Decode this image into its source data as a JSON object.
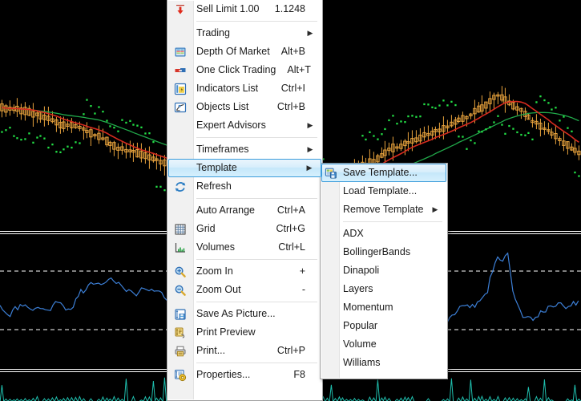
{
  "app": {
    "kind": "trading-terminal-chart-context-menu",
    "background_color": "#000000"
  },
  "chart_data": {
    "type": "line",
    "title": "",
    "panes": [
      {
        "name": "price",
        "type": "candlestick",
        "series": [
          {
            "name": "candles",
            "color": "#e8a33d"
          },
          {
            "name": "ma-fast",
            "color": "#d62b1f"
          },
          {
            "name": "ma-slow",
            "color": "#21a94a"
          },
          {
            "name": "parabolic-sar",
            "color": "#23e046"
          }
        ]
      },
      {
        "name": "oscillator",
        "type": "line",
        "series": [
          {
            "name": "rsi",
            "color": "#3c7fd6"
          }
        ],
        "levels": [
          70,
          30
        ],
        "level_style": "dashed",
        "level_color": "#ffffff"
      },
      {
        "name": "volumes",
        "type": "bar",
        "series": [
          {
            "name": "volume",
            "color": "#1fbfae"
          }
        ]
      }
    ]
  },
  "context_menu": {
    "name": "chart-context-menu",
    "items": [
      {
        "id": "sell-limit",
        "icon": "down-arrow-icon",
        "label": "Sell Limit 1.00",
        "accel": "1.1248",
        "arrow": false,
        "state": "normal"
      },
      {
        "id": "separator-1",
        "type": "separator"
      },
      {
        "id": "trading",
        "icon": "none",
        "label": "Trading",
        "accel": "",
        "arrow": true,
        "state": "normal"
      },
      {
        "id": "depth-of-market",
        "icon": "depth-of-market-icon",
        "label": "Depth Of Market",
        "accel": "Alt+B",
        "arrow": false,
        "state": "normal"
      },
      {
        "id": "one-click-trading",
        "icon": "one-click-trading-icon",
        "label": "One Click Trading",
        "accel": "Alt+T",
        "arrow": false,
        "state": "normal"
      },
      {
        "id": "indicators-list",
        "icon": "indicators-list-icon",
        "label": "Indicators List",
        "accel": "Ctrl+I",
        "arrow": false,
        "state": "normal"
      },
      {
        "id": "objects-list",
        "icon": "objects-list-icon",
        "label": "Objects List",
        "accel": "Ctrl+B",
        "arrow": false,
        "state": "normal"
      },
      {
        "id": "expert-advisors",
        "icon": "none",
        "label": "Expert Advisors",
        "accel": "",
        "arrow": true,
        "state": "normal"
      },
      {
        "id": "separator-2",
        "type": "separator"
      },
      {
        "id": "timeframes",
        "icon": "none",
        "label": "Timeframes",
        "accel": "",
        "arrow": true,
        "state": "normal"
      },
      {
        "id": "template",
        "icon": "none",
        "label": "Template",
        "accel": "",
        "arrow": true,
        "state": "highlighted"
      },
      {
        "id": "refresh",
        "icon": "refresh-icon",
        "label": "Refresh",
        "accel": "",
        "arrow": false,
        "state": "normal"
      },
      {
        "id": "separator-3",
        "type": "separator"
      },
      {
        "id": "auto-arrange",
        "icon": "none",
        "label": "Auto Arrange",
        "accel": "Ctrl+A",
        "arrow": false,
        "state": "normal"
      },
      {
        "id": "grid",
        "icon": "grid-icon",
        "label": "Grid",
        "accel": "Ctrl+G",
        "arrow": false,
        "state": "normal"
      },
      {
        "id": "volumes",
        "icon": "volumes-icon",
        "label": "Volumes",
        "accel": "Ctrl+L",
        "arrow": false,
        "state": "normal"
      },
      {
        "id": "separator-4",
        "type": "separator"
      },
      {
        "id": "zoom-in",
        "icon": "zoom-in-icon",
        "label": "Zoom In",
        "accel": "+",
        "arrow": false,
        "state": "normal"
      },
      {
        "id": "zoom-out",
        "icon": "zoom-out-icon",
        "label": "Zoom Out",
        "accel": "-",
        "arrow": false,
        "state": "normal"
      },
      {
        "id": "separator-5",
        "type": "separator"
      },
      {
        "id": "save-as-picture",
        "icon": "save-as-picture-icon",
        "label": "Save As Picture...",
        "accel": "",
        "arrow": false,
        "state": "normal"
      },
      {
        "id": "print-preview",
        "icon": "print-preview-icon",
        "label": "Print Preview",
        "accel": "",
        "arrow": false,
        "state": "normal"
      },
      {
        "id": "print",
        "icon": "print-icon",
        "label": "Print...",
        "accel": "Ctrl+P",
        "arrow": false,
        "state": "normal"
      },
      {
        "id": "separator-6",
        "type": "separator"
      },
      {
        "id": "properties",
        "icon": "properties-icon",
        "label": "Properties...",
        "accel": "F8",
        "arrow": false,
        "state": "normal"
      }
    ]
  },
  "template_submenu": {
    "name": "template-submenu",
    "items": [
      {
        "id": "save-template",
        "icon": "save-template-icon",
        "label": "Save Template...",
        "arrow": false,
        "state": "highlighted"
      },
      {
        "id": "load-template",
        "icon": "none",
        "label": "Load Template...",
        "arrow": false,
        "state": "normal"
      },
      {
        "id": "remove-template",
        "icon": "none",
        "label": "Remove Template",
        "arrow": true,
        "state": "normal"
      },
      {
        "id": "separator-1",
        "type": "separator"
      },
      {
        "id": "adx",
        "icon": "none",
        "label": "ADX",
        "arrow": false,
        "state": "normal"
      },
      {
        "id": "bollingerbands",
        "icon": "none",
        "label": "BollingerBands",
        "arrow": false,
        "state": "normal"
      },
      {
        "id": "dinapoli",
        "icon": "none",
        "label": "Dinapoli",
        "arrow": false,
        "state": "normal"
      },
      {
        "id": "layers",
        "icon": "none",
        "label": "Layers",
        "arrow": false,
        "state": "normal"
      },
      {
        "id": "momentum",
        "icon": "none",
        "label": "Momentum",
        "arrow": false,
        "state": "normal"
      },
      {
        "id": "popular",
        "icon": "none",
        "label": "Popular",
        "arrow": false,
        "state": "normal"
      },
      {
        "id": "volume",
        "icon": "none",
        "label": "Volume",
        "arrow": false,
        "state": "normal"
      },
      {
        "id": "williams",
        "icon": "none",
        "label": "Williams",
        "arrow": false,
        "state": "normal"
      }
    ]
  },
  "colors": {
    "menu_background": "#ffffff",
    "menu_gutter": "#f1f1f1",
    "highlight_border": "#3c9cdb",
    "candle": "#e8a33d",
    "ma_fast": "#d62b1f",
    "ma_slow": "#21a94a",
    "sar": "#23e046",
    "rsi": "#3c7fd6",
    "volume": "#1fbfae"
  }
}
